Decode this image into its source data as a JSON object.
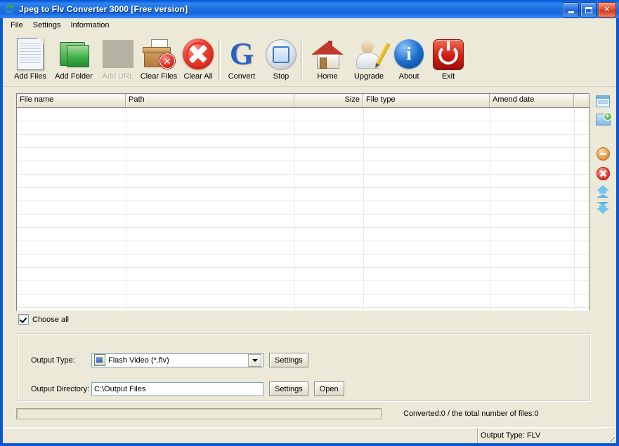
{
  "window": {
    "title": "Jpeg to Flv Converter 3000 [Free version]",
    "app_icon": "refresh-arrows-icon",
    "controls": {
      "minimize": "minimize-button",
      "maximize": "maximize-button",
      "close": "close-button"
    },
    "titlebar_color": "#0a58d6",
    "client_color": "#ece9d8"
  },
  "menu": {
    "items": [
      {
        "label": "File"
      },
      {
        "label": "Settings"
      },
      {
        "label": "Information"
      }
    ]
  },
  "toolbar": {
    "buttons": [
      {
        "label": "Add Files",
        "icon": "document-icon",
        "disabled": false
      },
      {
        "label": "Add Folder",
        "icon": "folder-icon",
        "disabled": false
      },
      {
        "label": "Add URL",
        "icon": "blank-icon",
        "disabled": true
      },
      {
        "label": "Clear Files",
        "icon": "trash-bin-icon",
        "disabled": false
      },
      {
        "label": "Clear All",
        "icon": "red-circle-x-icon",
        "disabled": false
      },
      {
        "label": "Convert",
        "icon": "convert-arrow-icon",
        "disabled": false
      },
      {
        "label": "Stop",
        "icon": "stop-button-icon",
        "disabled": false
      },
      {
        "label": "Home",
        "icon": "house-icon",
        "disabled": false
      },
      {
        "label": "Upgrade",
        "icon": "user-pencil-icon",
        "disabled": false
      },
      {
        "label": "About",
        "icon": "info-icon",
        "disabled": false
      },
      {
        "label": "Exit",
        "icon": "power-icon",
        "disabled": false
      }
    ]
  },
  "file_list": {
    "columns": [
      {
        "label": "File name",
        "align": "left"
      },
      {
        "label": "Path",
        "align": "left"
      },
      {
        "label": "Size",
        "align": "right"
      },
      {
        "label": "File type",
        "align": "left"
      },
      {
        "label": "Amend date",
        "align": "left"
      },
      {
        "label": "",
        "align": "left"
      }
    ],
    "rows": [],
    "empty": true,
    "visible_row_count": 15
  },
  "side_tools": [
    {
      "name": "add-file-icon",
      "tip": "Add file"
    },
    {
      "name": "add-folder-icon",
      "tip": "Add folder"
    },
    {
      "name": "remove-icon",
      "tip": "Remove"
    },
    {
      "name": "remove-all-icon",
      "tip": "Remove all"
    },
    {
      "name": "move-up-icon",
      "tip": "Move up"
    },
    {
      "name": "move-down-icon",
      "tip": "Move down"
    }
  ],
  "choose_all": {
    "label": "Choose all",
    "checked": true
  },
  "output": {
    "type_label": "Output Type:",
    "type_value": "Flash Video (*.flv)",
    "type_settings_label": "Settings",
    "directory_label": "Output Directory:",
    "directory_value": "C:\\Output Files",
    "directory_placeholder": "C:\\Output Files",
    "directory_settings_label": "Settings",
    "directory_open_label": "Open"
  },
  "progress": {
    "value": 0
  },
  "status": {
    "converted_text": "Converted:0  /  the total number of files:0",
    "output_type_text": "Output Type: FLV"
  }
}
